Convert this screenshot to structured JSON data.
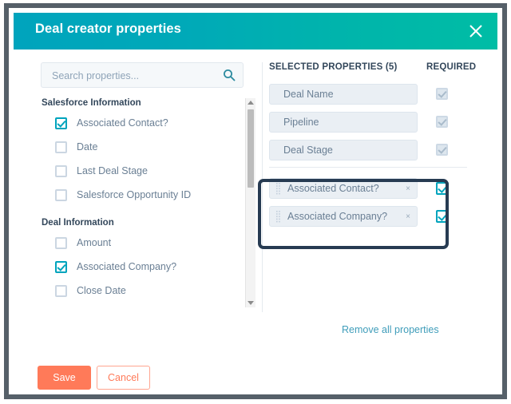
{
  "dialog": {
    "title": "Deal creator properties",
    "close_icon": "close-icon"
  },
  "search": {
    "placeholder": "Search properties...",
    "value": "",
    "icon": "search-icon"
  },
  "left_panel": {
    "sections": [
      {
        "heading": "Salesforce Information",
        "items": [
          {
            "label": "Associated Contact?",
            "checked": true
          },
          {
            "label": "Date",
            "checked": false
          },
          {
            "label": "Last Deal Stage",
            "checked": false
          },
          {
            "label": "Salesforce Opportunity ID",
            "checked": false
          }
        ]
      },
      {
        "heading": "Deal Information",
        "items": [
          {
            "label": "Amount",
            "checked": false
          },
          {
            "label": "Associated Company?",
            "checked": true
          },
          {
            "label": "Close Date",
            "checked": false
          }
        ]
      }
    ],
    "scrollbar": {
      "up_icon": "chevron-up-icon",
      "down_icon": "chevron-down-icon"
    }
  },
  "right_panel": {
    "selected_header": "SELECTED PROPERTIES (5)",
    "required_header": "REQUIRED",
    "locked_rows": [
      {
        "label": "Deal Name",
        "required": true
      },
      {
        "label": "Pipeline",
        "required": true
      },
      {
        "label": "Deal Stage",
        "required": true
      }
    ],
    "draggable_rows": [
      {
        "label": "Associated Contact?",
        "required": true,
        "grip_icon": "drag-handle-icon",
        "remove_icon": "remove-icon",
        "remove_glyph": "×"
      },
      {
        "label": "Associated Company?",
        "required": true,
        "grip_icon": "drag-handle-icon",
        "remove_icon": "remove-icon",
        "remove_glyph": "×"
      }
    ],
    "remove_all_label": "Remove all properties"
  },
  "footer": {
    "save_label": "Save",
    "cancel_label": "Cancel"
  },
  "colors": {
    "header_gradient_start": "#00a4bd",
    "header_gradient_end": "#00bda5",
    "accent_teal": "#00a4bd",
    "link_teal": "#3f9dba",
    "primary_button": "#ff7a59",
    "annotation": "#273b52",
    "text_dark": "#33475b",
    "text_muted": "#6a7f94",
    "frame": "#566069"
  }
}
